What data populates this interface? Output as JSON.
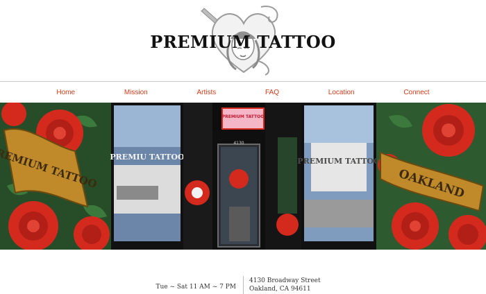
{
  "brand": {
    "title": "PREMIUM TATTOO"
  },
  "nav": {
    "home": "Home",
    "mission": "Mission",
    "artists": "Artists",
    "faq": "FAQ",
    "location": "Location",
    "connect": "Connect"
  },
  "hero": {
    "left_banner": "PREMIUM TATTOO",
    "right_banner": "OAKLAND",
    "neon_sign": "PREMIUM TATTOO",
    "address_number": "4130"
  },
  "footer": {
    "hours": "Tue ~ Sat 11 AM ~ 7 PM",
    "address_line1": "4130 Broadway Street",
    "address_line2": "Oakland, CA 94611"
  },
  "colors": {
    "nav_link": "#d33a1a",
    "rose": "#d42a1e",
    "leaf": "#2f6b34"
  }
}
